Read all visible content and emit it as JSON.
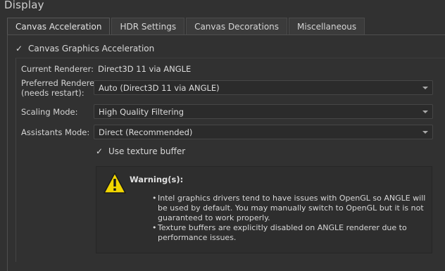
{
  "section_title": "Display",
  "tabs": [
    {
      "label": "Canvas Acceleration",
      "active": true
    },
    {
      "label": "HDR Settings",
      "active": false
    },
    {
      "label": "Canvas Decorations",
      "active": false
    },
    {
      "label": "Miscellaneous",
      "active": false
    }
  ],
  "canvas_graphics_acceleration": {
    "label": "Canvas Graphics Acceleration",
    "checked": true
  },
  "current_renderer": {
    "label": "Current Renderer:",
    "value": "Direct3D 11 via ANGLE"
  },
  "preferred_renderer": {
    "label_line1": "Preferred Renderer",
    "label_line2": "(needs restart):",
    "value": "Auto (Direct3D 11 via ANGLE)"
  },
  "scaling_mode": {
    "label": "Scaling Mode:",
    "value": "High Quality Filtering"
  },
  "assistants_mode": {
    "label": "Assistants Mode:",
    "value": "Direct (Recommended)"
  },
  "use_texture_buffer": {
    "label": "Use texture buffer",
    "checked": true
  },
  "warning": {
    "title": "Warning(s):",
    "items": [
      "Intel graphics drivers tend to have issues with OpenGL so ANGLE will be used by default. You may manually switch to OpenGL but it is not guaranteed to work properly.",
      "Texture buffers are explicitly disabled on ANGLE renderer due to performance issues."
    ]
  },
  "colors": {
    "background": "#313131",
    "warning_icon": "#f2d600"
  }
}
